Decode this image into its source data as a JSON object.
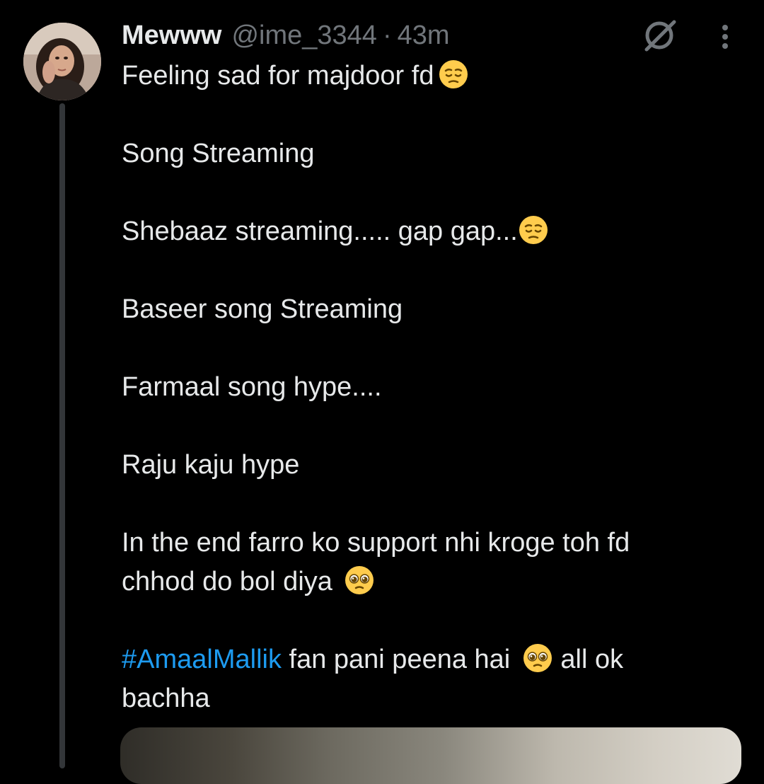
{
  "tweet": {
    "author": {
      "display_name": "Mewww",
      "handle": "@ime_3344"
    },
    "separator": "·",
    "time": "43m",
    "lines": [
      {
        "text": "Feeling sad for majdoor fd",
        "emoji": "pensive-face"
      },
      {
        "text": "Song Streaming"
      },
      {
        "text": "Shebaaz streaming..... gap gap...",
        "emoji": "pensive-face"
      },
      {
        "text": "Baseer song Streaming"
      },
      {
        "text": "Farmaal song hype...."
      },
      {
        "text": "Raju kaju hype"
      },
      {
        "text": "In the end farro ko support nhi kroge toh fd"
      },
      {
        "text": "chhod do bol diya",
        "emoji": "pleading-face"
      },
      {
        "hashtag": "#AmaalMallik",
        "text": " fan pani peena hai",
        "emoji": "pleading-face",
        "after": " all ok"
      },
      {
        "text": "bachha"
      }
    ],
    "icons": {
      "grok": "grok-icon",
      "more": "more-icon",
      "pensive": "pensive-face-emoji",
      "pleading": "pleading-face-emoji"
    },
    "colors": {
      "background": "#000000",
      "text": "#e7e9ea",
      "secondary": "#71767b",
      "link": "#1d9bf0",
      "thread_line": "#333639"
    }
  }
}
